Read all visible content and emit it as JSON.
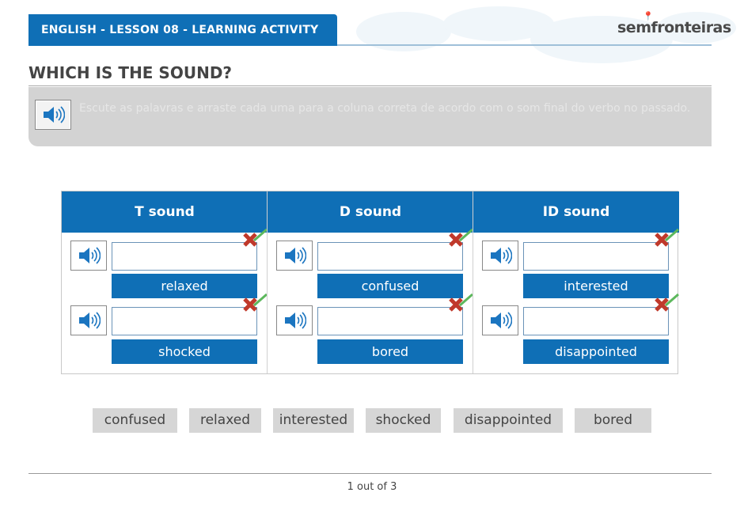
{
  "header": {
    "title": "ENGLISH - LESSON 08 - LEARNING ACTIVITY"
  },
  "logo": {
    "brand": "semfronteiras"
  },
  "activity": {
    "title": "WHICH IS THE SOUND?",
    "instructions": "Escute as palavras e arraste cada uma para a coluna correta de acordo com o som final do verbo no passado.",
    "columns": [
      {
        "header": "T sound",
        "cells": [
          {
            "value": "",
            "label": "relaxed"
          },
          {
            "value": "",
            "label": "shocked"
          }
        ]
      },
      {
        "header": "D sound",
        "cells": [
          {
            "value": "",
            "label": "confused"
          },
          {
            "value": "",
            "label": "bored"
          }
        ]
      },
      {
        "header": "ID sound",
        "cells": [
          {
            "value": "",
            "label": "interested"
          },
          {
            "value": "",
            "label": "disappointed"
          }
        ]
      }
    ],
    "word_bank": [
      "confused",
      "relaxed",
      "interested",
      "shocked",
      "disappointed",
      "bored"
    ]
  },
  "pagination": {
    "text": "1 out of 3"
  },
  "colors": {
    "primary": "#0f6fb6",
    "bank": "#d6d6d6",
    "wrong": "#c0392b",
    "right": "#5cb85c"
  },
  "icons": {
    "speaker": "speaker-icon",
    "wrong": "x-mark-icon",
    "right": "checkmark-icon"
  }
}
